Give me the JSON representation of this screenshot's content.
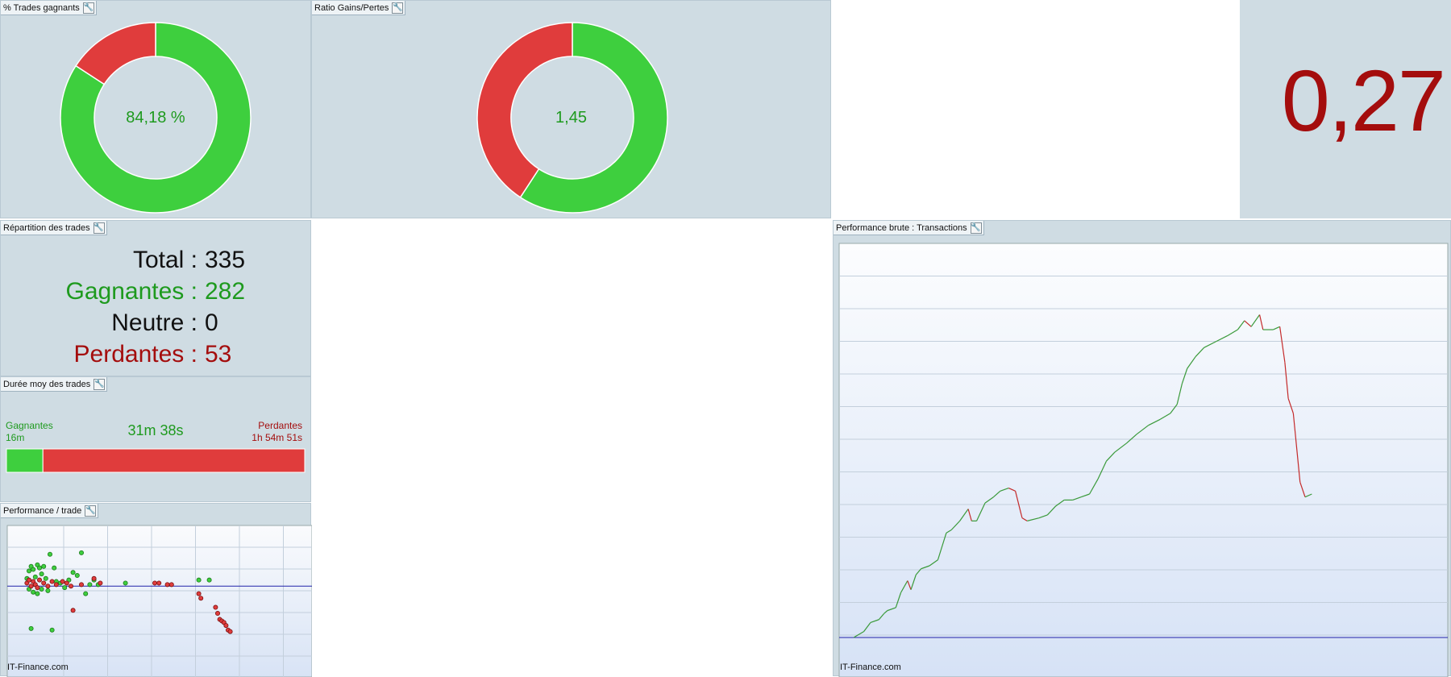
{
  "colors": {
    "green": "#3ecf3e",
    "red": "#e03c3c",
    "text_green": "#1e9a1e",
    "text_red": "#a40d0d",
    "baseline": "#2222aa"
  },
  "panels": {
    "win_pct": {
      "title": "% Trades gagnants",
      "center_text": "84,18 %"
    },
    "gain_loss": {
      "title": "Ratio Gains/Pertes",
      "center_text": "1,45"
    },
    "big_value": {
      "value": "0,27"
    },
    "repartition": {
      "title": "Répartition des trades",
      "rows": [
        {
          "label": "Total",
          "sep": ":",
          "value": "335",
          "color": "#111111"
        },
        {
          "label": "Gagnantes",
          "sep": ":",
          "value": "282",
          "color": "#1e9a1e"
        },
        {
          "label": "Neutre",
          "sep": ":",
          "value": "0",
          "color": "#111111"
        },
        {
          "label": "Perdantes",
          "sep": ":",
          "value": "53",
          "color": "#a40d0d"
        }
      ]
    },
    "duration": {
      "title": "Durée moy des trades",
      "win_label": "Gagnantes",
      "win_value": "16m",
      "avg_value": "31m 38s",
      "loss_label": "Perdantes",
      "loss_value": "1h 54m 51s"
    },
    "perf_trade": {
      "title": "Performance / trade",
      "watermark": "IT-Finance.com"
    },
    "perf_brute": {
      "title": "Performance brute : Transactions",
      "watermark": "IT-Finance.com"
    }
  },
  "chart_data": [
    {
      "type": "pie",
      "title": "% Trades gagnants",
      "slices": [
        {
          "label": "Gagnantes",
          "value": 84.18,
          "color": "#3ecf3e"
        },
        {
          "label": "Perdantes",
          "value": 15.82,
          "color": "#e03c3c"
        }
      ],
      "center_label": "84,18 %"
    },
    {
      "type": "pie",
      "title": "Ratio Gains/Pertes",
      "slices": [
        {
          "label": "Gains",
          "value": 59.2,
          "color": "#3ecf3e"
        },
        {
          "label": "Pertes",
          "value": 40.8,
          "color": "#e03c3c"
        }
      ],
      "center_label": "1,45"
    },
    {
      "type": "bar",
      "title": "Durée moy des trades",
      "categories": [
        "Gagnantes",
        "Perdantes"
      ],
      "values": [
        16,
        114.85
      ],
      "colors": [
        "#3ecf3e",
        "#e03c3c"
      ]
    },
    {
      "type": "scatter",
      "title": "Performance / trade",
      "grid": true,
      "xlim": [
        0,
        14
      ],
      "ylim": [
        -6,
        4
      ],
      "baseline": 0,
      "series": [
        {
          "values": [
            [
              0.4,
              0.5
            ],
            [
              0.5,
              1.0
            ],
            [
              0.6,
              1.3
            ],
            [
              0.7,
              1.1
            ],
            [
              0.8,
              0.6
            ],
            [
              0.9,
              1.4
            ],
            [
              1.0,
              1.2
            ],
            [
              1.1,
              0.8
            ],
            [
              1.2,
              1.3
            ],
            [
              1.3,
              0.5
            ],
            [
              1.5,
              2.1
            ],
            [
              1.7,
              1.2
            ],
            [
              0.5,
              -0.2
            ],
            [
              0.7,
              -0.4
            ],
            [
              0.9,
              -0.5
            ],
            [
              1.1,
              -0.2
            ],
            [
              1.4,
              -0.3
            ],
            [
              1.8,
              0.3
            ],
            [
              2.0,
              0.2
            ],
            [
              2.2,
              -0.1
            ],
            [
              2.4,
              0.4
            ],
            [
              2.6,
              0.9
            ],
            [
              2.8,
              0.7
            ],
            [
              3.0,
              2.2
            ],
            [
              3.2,
              -0.5
            ],
            [
              3.4,
              0.1
            ],
            [
              3.6,
              0.4
            ],
            [
              3.8,
              0.1
            ],
            [
              5.1,
              0.2
            ],
            [
              8.6,
              0.4
            ],
            [
              9.1,
              0.4
            ],
            [
              0.6,
              -2.8
            ],
            [
              1.6,
              -2.9
            ]
          ],
          "color": "#3ecf3e"
        },
        {
          "values": [
            [
              0.4,
              0.2
            ],
            [
              0.5,
              0.4
            ],
            [
              0.6,
              0.0
            ],
            [
              0.7,
              0.3
            ],
            [
              0.8,
              0.1
            ],
            [
              0.9,
              -0.1
            ],
            [
              1.0,
              0.4
            ],
            [
              1.2,
              0.2
            ],
            [
              1.4,
              0.0
            ],
            [
              1.6,
              0.3
            ],
            [
              1.8,
              0.1
            ],
            [
              2.1,
              0.3
            ],
            [
              2.3,
              0.2
            ],
            [
              2.5,
              0.0
            ],
            [
              3.0,
              0.1
            ],
            [
              3.6,
              0.5
            ],
            [
              3.9,
              0.2
            ],
            [
              6.5,
              0.2
            ],
            [
              6.7,
              0.2
            ],
            [
              7.1,
              0.1
            ],
            [
              7.3,
              0.1
            ],
            [
              2.6,
              -1.6
            ],
            [
              8.6,
              -0.5
            ],
            [
              8.7,
              -0.8
            ],
            [
              9.4,
              -1.4
            ],
            [
              9.5,
              -1.8
            ],
            [
              9.6,
              -2.2
            ],
            [
              9.7,
              -2.3
            ],
            [
              9.8,
              -2.4
            ],
            [
              9.9,
              -2.6
            ],
            [
              10.0,
              -2.9
            ],
            [
              10.1,
              -3.0
            ]
          ],
          "color": "#e03c3c"
        }
      ]
    },
    {
      "type": "line",
      "title": "Performance brute : Transactions",
      "grid": true,
      "xlim": [
        0,
        335
      ],
      "ylim": [
        0,
        12
      ],
      "baseline": 0,
      "series": [
        {
          "values": [
            [
              0,
              0
            ],
            [
              6,
              0.2
            ],
            [
              10,
              0.5
            ],
            [
              15,
              0.6
            ],
            [
              18,
              0.8
            ],
            [
              20,
              0.9
            ],
            [
              25,
              1.0
            ],
            [
              28,
              1.5
            ],
            [
              30,
              1.7
            ],
            [
              32,
              1.9
            ],
            [
              34,
              1.6
            ],
            [
              37,
              2.1
            ],
            [
              40,
              2.3
            ],
            [
              45,
              2.4
            ],
            [
              50,
              2.6
            ],
            [
              55,
              3.5
            ],
            [
              58,
              3.6
            ],
            [
              63,
              3.9
            ],
            [
              68,
              4.3
            ],
            [
              70,
              3.9
            ],
            [
              73,
              3.9
            ],
            [
              78,
              4.5
            ],
            [
              83,
              4.7
            ],
            [
              87,
              4.9
            ],
            [
              92,
              5.0
            ],
            [
              96,
              4.9
            ],
            [
              100,
              4.0
            ],
            [
              103,
              3.9
            ],
            [
              110,
              4.0
            ],
            [
              115,
              4.1
            ],
            [
              120,
              4.4
            ],
            [
              125,
              4.6
            ],
            [
              130,
              4.6
            ],
            [
              135,
              4.7
            ],
            [
              140,
              4.8
            ],
            [
              145,
              5.3
            ],
            [
              150,
              5.9
            ],
            [
              155,
              6.2
            ],
            [
              162,
              6.5
            ],
            [
              168,
              6.8
            ],
            [
              175,
              7.1
            ],
            [
              182,
              7.3
            ],
            [
              188,
              7.5
            ],
            [
              192,
              7.8
            ],
            [
              195,
              8.5
            ],
            [
              198,
              9.0
            ],
            [
              203,
              9.4
            ],
            [
              208,
              9.7
            ],
            [
              215,
              9.9
            ],
            [
              222,
              10.1
            ],
            [
              228,
              10.3
            ],
            [
              232,
              10.6
            ],
            [
              236,
              10.4
            ],
            [
              241,
              10.8
            ],
            [
              243,
              10.3
            ],
            [
              249,
              10.3
            ],
            [
              253,
              10.4
            ],
            [
              256,
              9.2
            ],
            [
              258,
              8.0
            ],
            [
              261,
              7.5
            ],
            [
              265,
              5.2
            ],
            [
              268,
              4.7
            ],
            [
              272,
              4.8
            ]
          ],
          "color": "#3a9a3a"
        }
      ]
    }
  ]
}
